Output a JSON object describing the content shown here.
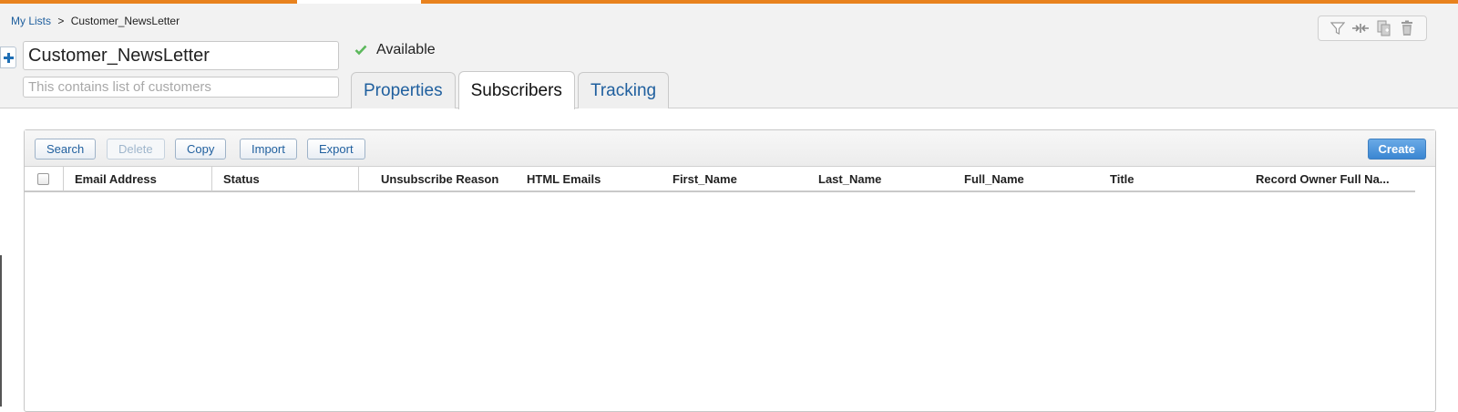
{
  "breadcrumb": {
    "root": "My Lists",
    "separator": ">",
    "current": "Customer_NewsLetter"
  },
  "toolbar_icons": [
    "filter-icon",
    "merge-icon",
    "duplicate-icon",
    "trash-icon"
  ],
  "list": {
    "name": "Customer_NewsLetter",
    "description_placeholder": "This contains list of customers",
    "status": "Available",
    "status_color": "#5cb85c"
  },
  "tabs": [
    {
      "label": "Properties",
      "active": false
    },
    {
      "label": "Subscribers",
      "active": true
    },
    {
      "label": "Tracking",
      "active": false
    }
  ],
  "panel": {
    "buttons": [
      "Search",
      "Delete",
      "Copy",
      "Import",
      "Export"
    ],
    "create_label": "Create"
  },
  "grid": {
    "columns": [
      "Email Address",
      "Status",
      "Unsubscribe Reason",
      "HTML Emails",
      "First_Name",
      "Last_Name",
      "Full_Name",
      "Title",
      "Record Owner Full Na..."
    ],
    "rows": []
  },
  "colors": {
    "accent": "#e8821e",
    "link": "#1f5f9e",
    "primary_button": "#3a86d2"
  }
}
